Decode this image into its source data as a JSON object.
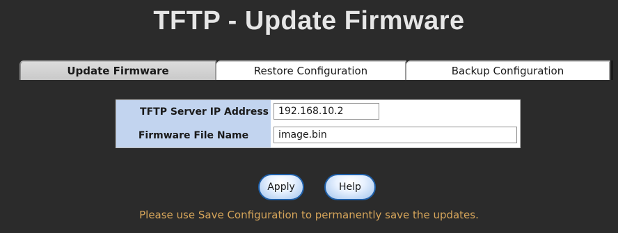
{
  "page": {
    "title": "TFTP - Update Firmware"
  },
  "tabs": [
    {
      "label": "Update Firmware",
      "active": true
    },
    {
      "label": "Restore Configuration",
      "active": false
    },
    {
      "label": "Backup Configuration",
      "active": false
    }
  ],
  "form": {
    "server_ip": {
      "label": "TFTP Server IP Address",
      "value": "192.168.10.2"
    },
    "file_name": {
      "label": "Firmware File Name",
      "value": "image.bin"
    }
  },
  "buttons": {
    "apply_label": "Apply",
    "help_label": "Help"
  },
  "note": "Please use Save Configuration to permanently save the updates.",
  "colors": {
    "background": "#2b2b2b",
    "label_bg": "#c2d4ef",
    "note_text": "#d6a55a",
    "button_border": "#1f5fa8"
  }
}
